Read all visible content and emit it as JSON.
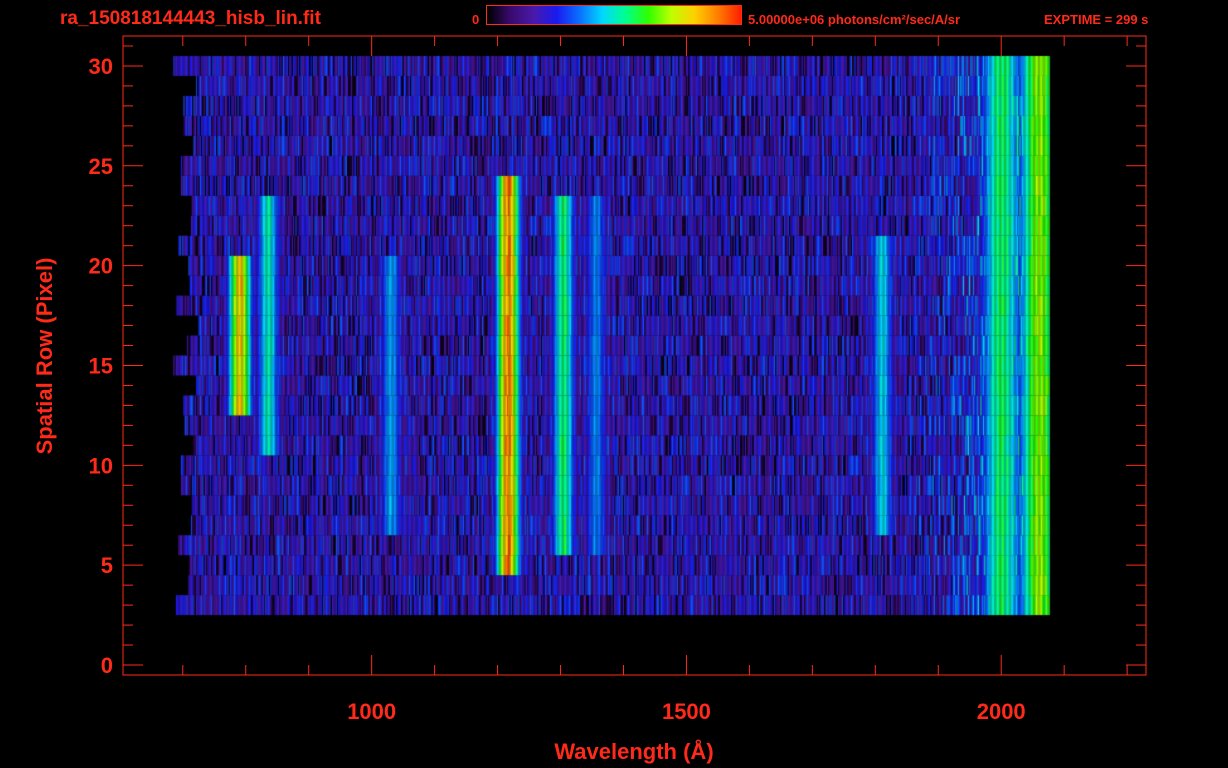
{
  "header": {
    "file_title": "ra_150818144443_hisb_lin.fit",
    "colorbar_min": "0",
    "colorbar_max": "5.00000e+06 photons/cm²/sec/A/sr",
    "exptime": "EXPTIME = 299 s"
  },
  "colors": {
    "annotation": "#ff2a1a",
    "background": "#000000",
    "colormap": [
      "#000000",
      "#3a0a6e",
      "#4a1aaa",
      "#1a1af0",
      "#0a70ff",
      "#00d8ff",
      "#00ff90",
      "#30ff00",
      "#c0ff00",
      "#ffd000",
      "#ff8000",
      "#ff2000"
    ]
  },
  "chart_data": {
    "type": "heatmap",
    "title": "",
    "xlabel": "Wavelength (Å)",
    "ylabel": "Spatial Row (Pixel)",
    "xlim": [
      605,
      2230
    ],
    "ylim": [
      -0.5,
      31.5
    ],
    "xticks": [
      1000,
      1500,
      2000
    ],
    "xtick_labels": [
      "1000",
      "1500",
      "2000"
    ],
    "yticks": [
      0,
      5,
      10,
      15,
      20,
      25,
      30
    ],
    "ytick_labels": [
      "0",
      "5",
      "10",
      "15",
      "20",
      "25",
      "30"
    ],
    "colorbar": {
      "min": 0,
      "max": 5000000,
      "units": "photons/cm²/sec/A/sr"
    },
    "exposure_time_s": 299,
    "data_extent": {
      "x_start": 685,
      "x_end": 2075,
      "rows_start": 3,
      "rows_end": 30
    },
    "emission_features": [
      {
        "wavelength": 790,
        "rows": [
          13,
          20
        ],
        "peak_fraction": 0.88
      },
      {
        "wavelength": 835,
        "rows": [
          11,
          23
        ],
        "peak_fraction": 0.55
      },
      {
        "wavelength": 1030,
        "rows": [
          7,
          20
        ],
        "peak_fraction": 0.45
      },
      {
        "wavelength": 1216,
        "rows": [
          5,
          24
        ],
        "peak_fraction": 0.97
      },
      {
        "wavelength": 1304,
        "rows": [
          6,
          23
        ],
        "peak_fraction": 0.62
      },
      {
        "wavelength": 1356,
        "rows": [
          6,
          23
        ],
        "peak_fraction": 0.42
      },
      {
        "wavelength": 1810,
        "rows": [
          7,
          21
        ],
        "peak_fraction": 0.5
      },
      {
        "wavelength": 2000,
        "rows": [
          3,
          30
        ],
        "peak_fraction": 0.62
      },
      {
        "wavelength": 2060,
        "rows": [
          3,
          30
        ],
        "peak_fraction": 0.75
      }
    ]
  }
}
